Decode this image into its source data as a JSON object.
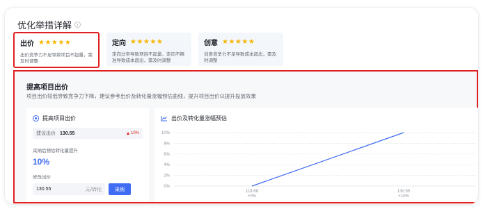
{
  "section": {
    "title": "优化举措详解"
  },
  "cards": [
    {
      "name": "出价",
      "stars": "★★★★★",
      "desc": "出价竞争力不足导致项目不起量，需及时调整"
    },
    {
      "name": "定向",
      "stars": "★★★★★",
      "desc": "定向过窄导致项目不起量，定向不精准导致成本超出，需及时调整"
    },
    {
      "name": "创意",
      "stars": "★★★★★",
      "desc": "创意竞争力不足导致成本超出，需及时调整"
    }
  ],
  "panel": {
    "title": "提高项目出价",
    "subtitle": "项目出价较低导致竞争力下降，建议参考出价及转化量涨幅预估曲线，提升项目出价以提升投放效果",
    "option_label": "提高项目出价",
    "suggest_label": "建议出价",
    "suggest_value": "130.55",
    "suggest_change": "10%",
    "lift_label": "采纳后预估转化量提升",
    "lift_value": "10%",
    "edit_label": "修改出价",
    "bid_value": "130.55",
    "bid_unit": "元/转化",
    "adopt_button": "采纳"
  },
  "colors": {
    "accent": "#3f6cf2",
    "highlight": "#e02020",
    "star": "#f7b500"
  },
  "chart_data": {
    "type": "line",
    "title": "出价及转化量涨幅预估",
    "x": [
      "118.68",
      "130.55"
    ],
    "x_sublabels": [
      "+0%",
      "+10%"
    ],
    "series": [
      {
        "values": [
          0,
          10
        ]
      }
    ],
    "y_ticks": [
      "10%",
      "8%",
      "6%",
      "4%",
      "2%",
      "0%"
    ],
    "ylim": [
      0,
      10
    ],
    "grid": true
  }
}
